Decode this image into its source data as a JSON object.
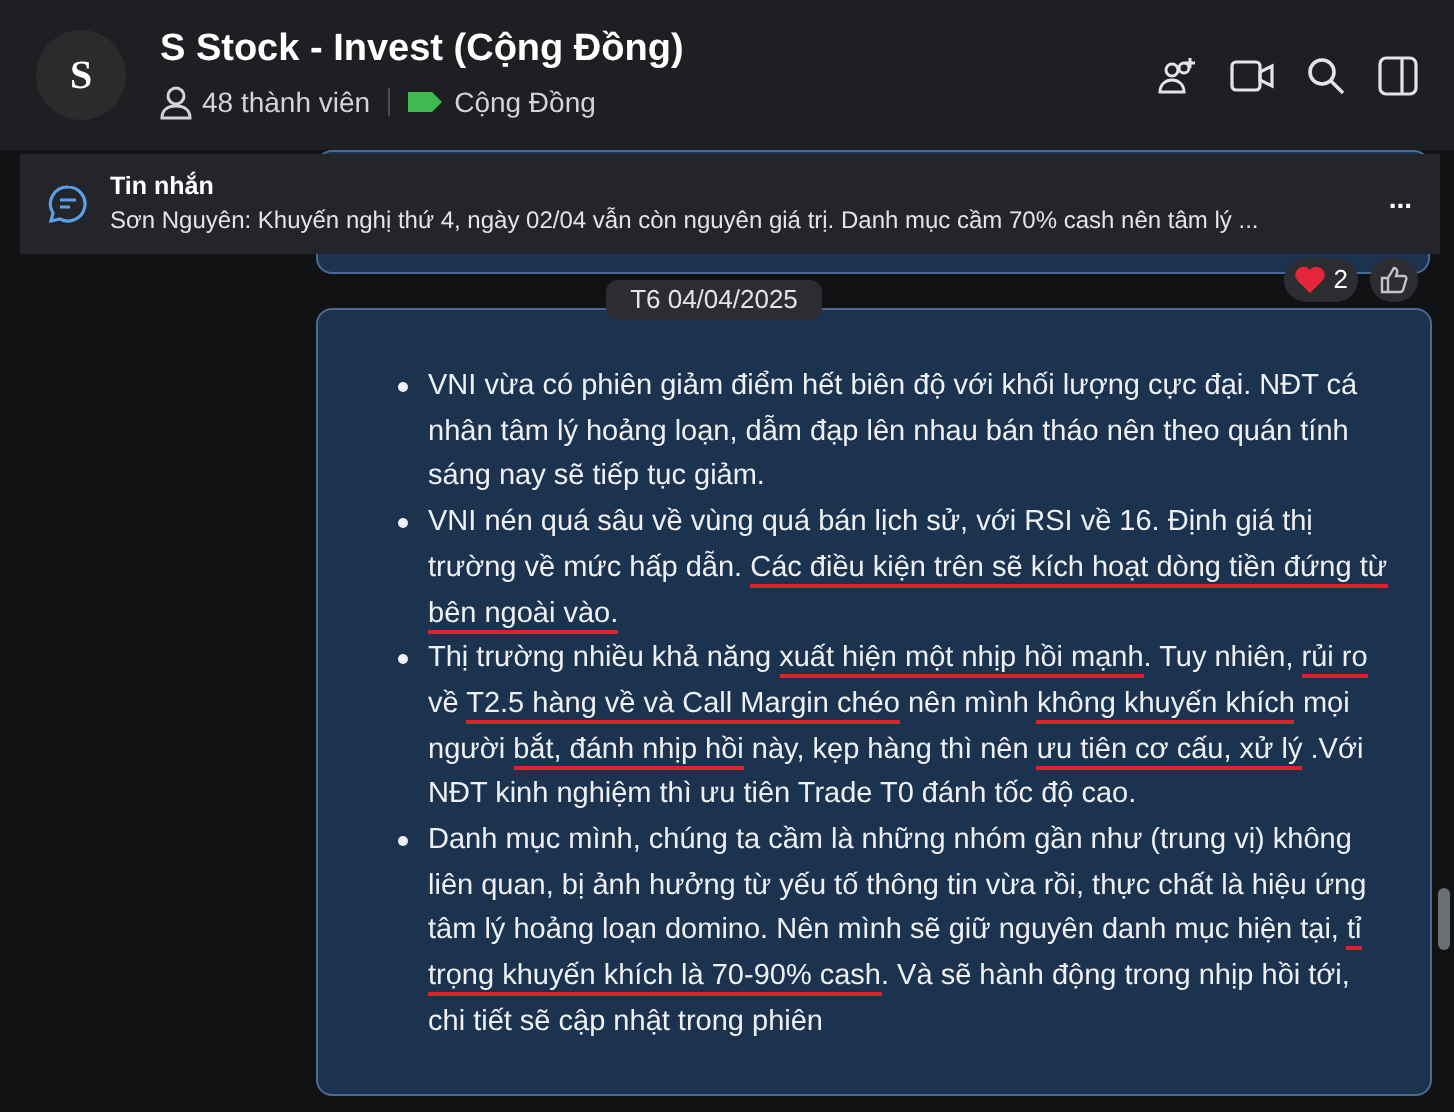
{
  "header": {
    "avatar_letter": "S",
    "title": "S Stock - Invest (Cộng Đồng)",
    "members": "48 thành viên",
    "category": "Cộng Đồng"
  },
  "pinned": {
    "label": "Tin nhắn",
    "text": "Sơn Nguyên: Khuyến nghị thứ 4, ngày 02/04 vẫn còn nguyên giá trị. Danh mục cầm 70% cash nên tâm lý ...",
    "more": "..."
  },
  "reactions": [
    {
      "kind": "heart",
      "count": "2"
    },
    {
      "kind": "like"
    }
  ],
  "date_separator": "T6 04/04/2025",
  "message": {
    "bullets": [
      {
        "segments": [
          {
            "text": "VNI vừa có phiên giảm điểm hết biên độ với khối lượng cực đại. NĐT cá nhân tâm lý hoảng loạn, dẫm đạp lên nhau bán tháo nên theo quán tính sáng nay sẽ tiếp tục giảm.",
            "underlined": false
          }
        ]
      },
      {
        "segments": [
          {
            "text": "VNI nén quá sâu về vùng quá bán lịch sử, với RSI về 16. Định giá thị trường về mức hấp dẫn. ",
            "underlined": false
          },
          {
            "text": "Các điều kiện trên sẽ kích hoạt dòng tiền đứng từ bên ngoài vào.",
            "underlined": true
          }
        ]
      },
      {
        "segments": [
          {
            "text": "Thị trường nhiều khả năng ",
            "underlined": false
          },
          {
            "text": "xuất hiện một nhịp hồi mạnh",
            "underlined": true
          },
          {
            "text": ". Tuy nhiên, ",
            "underlined": false
          },
          {
            "text": "rủi ro",
            "underlined": true
          },
          {
            "text": " về ",
            "underlined": false
          },
          {
            "text": "T2.5 hàng về và Call Margin chéo",
            "underlined": true
          },
          {
            "text": " nên mình ",
            "underlined": false
          },
          {
            "text": "không khuyến khích",
            "underlined": true
          },
          {
            "text": " mọi người ",
            "underlined": false
          },
          {
            "text": "bắt, đánh nhịp hồi",
            "underlined": true
          },
          {
            "text": " này, kẹp hàng thì nên ",
            "underlined": false
          },
          {
            "text": "ưu tiên cơ cấu, xử lý",
            "underlined": true
          },
          {
            "text": " .Với NĐT kinh nghiệm thì ưu tiên Trade T0 đánh tốc độ cao.",
            "underlined": false
          }
        ]
      },
      {
        "segments": [
          {
            "text": "Danh mục mình, chúng ta cầm là những nhóm gần như (trung vị) không liên quan, bị ảnh hưởng từ yếu tố thông tin vừa rồi, thực chất là hiệu ứng tâm lý hoảng loạn domino.  Nên mình sẽ giữ nguyên danh mục hiện tại, ",
            "underlined": false
          },
          {
            "text": "tỉ trọng khuyến khích là 70-90% cash",
            "underlined": true
          },
          {
            "text": ". Và sẽ hành động trong nhịp hồi tới, chi tiết sẽ cập nhật trong phiên",
            "underlined": false
          }
        ]
      }
    ]
  }
}
